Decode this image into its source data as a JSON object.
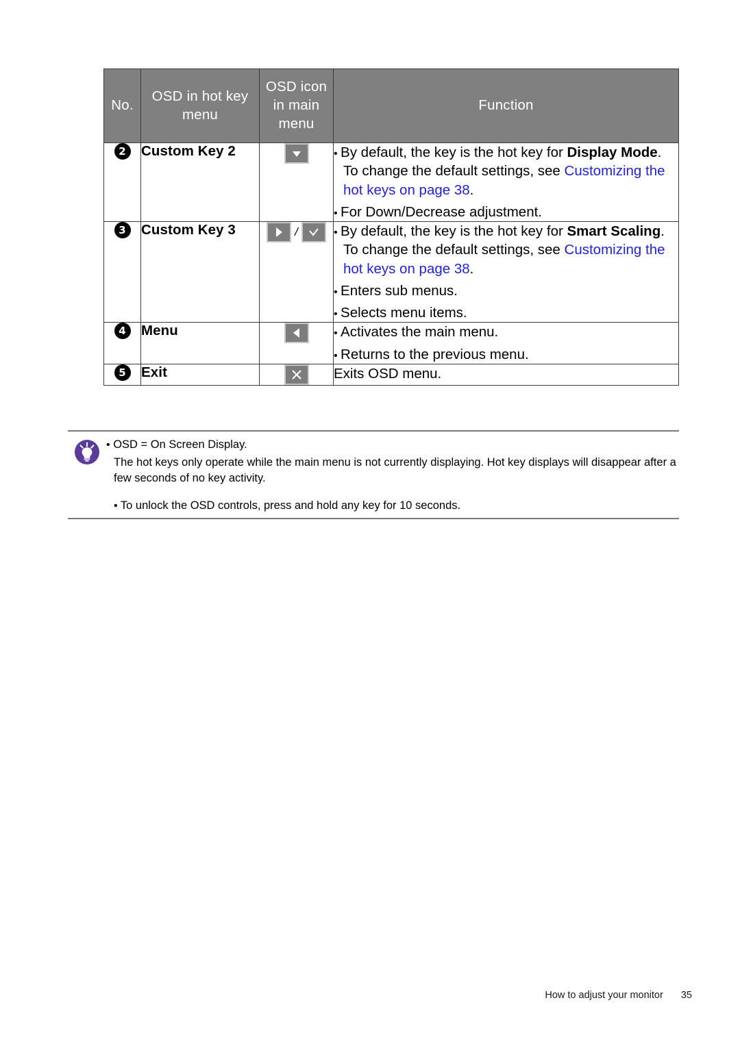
{
  "table": {
    "headers": {
      "no": "No.",
      "hotkey_menu": "OSD in hot key menu",
      "hotkey_menu_l1": "OSD in hot key",
      "hotkey_menu_l2": "menu",
      "osd_icon_l1": "OSD icon",
      "osd_icon_l2": "in main",
      "osd_icon_l3": "menu",
      "function": "Function"
    },
    "rows": [
      {
        "number": "2",
        "hotkey_label": "Custom Key 2",
        "icons": [
          "down-triangle-icon"
        ],
        "functions": [
          {
            "bullet": true,
            "parts": [
              {
                "text": "By default, the key is the hot key for ",
                "style": "normal"
              },
              {
                "text": "Display Mode",
                "style": "bold"
              },
              {
                "text": ". To change the default settings, see ",
                "style": "normal"
              },
              {
                "text": "Customizing the hot keys on page 38",
                "style": "link"
              },
              {
                "text": ".",
                "style": "normal"
              }
            ]
          },
          {
            "bullet": true,
            "parts": [
              {
                "text": "For Down/Decrease adjustment.",
                "style": "normal"
              }
            ]
          }
        ]
      },
      {
        "number": "3",
        "hotkey_label": "Custom Key 3",
        "icons": [
          "right-triangle-icon",
          "check-icon"
        ],
        "icon_separator": "/",
        "functions": [
          {
            "bullet": true,
            "parts": [
              {
                "text": "By default, the key is the hot key for ",
                "style": "normal"
              },
              {
                "text": "Smart Scaling",
                "style": "bold"
              },
              {
                "text": ". To change the default settings, see ",
                "style": "normal"
              },
              {
                "text": "Customizing the hot keys on page 38",
                "style": "link"
              },
              {
                "text": ".",
                "style": "normal"
              }
            ]
          },
          {
            "bullet": true,
            "parts": [
              {
                "text": "Enters sub menus.",
                "style": "normal"
              }
            ]
          },
          {
            "bullet": true,
            "parts": [
              {
                "text": "Selects menu items.",
                "style": "normal"
              }
            ]
          }
        ]
      },
      {
        "number": "4",
        "hotkey_label": "Menu",
        "icons": [
          "left-triangle-icon"
        ],
        "functions": [
          {
            "bullet": true,
            "parts": [
              {
                "text": "Activates the main menu.",
                "style": "normal"
              }
            ]
          },
          {
            "bullet": true,
            "parts": [
              {
                "text": "Returns to the previous menu.",
                "style": "normal"
              }
            ]
          }
        ]
      },
      {
        "number": "5",
        "hotkey_label": "Exit",
        "icons": [
          "close-x-icon"
        ],
        "functions": [
          {
            "bullet": false,
            "parts": [
              {
                "text": "Exits OSD menu.",
                "style": "normal"
              }
            ]
          }
        ]
      }
    ]
  },
  "note": {
    "icon": "tip-lightbulb-icon",
    "line1": "OSD = On Screen Display.",
    "line2": "The hot keys only operate while the main menu is not currently displaying. Hot key displays will disappear after a few seconds of no key activity.",
    "line3": "To unlock the OSD controls, press and hold any key for 10 seconds.",
    "bullet": "•"
  },
  "footer": {
    "section_title": "How to adjust your monitor",
    "page_number": "35"
  },
  "colors": {
    "header_gray": "#808080",
    "link_blue": "#2222dd",
    "tip_purple": "#5b3a9b",
    "osd_button_face": "#7d7d7d",
    "osd_button_border": "#c9c9c9"
  }
}
